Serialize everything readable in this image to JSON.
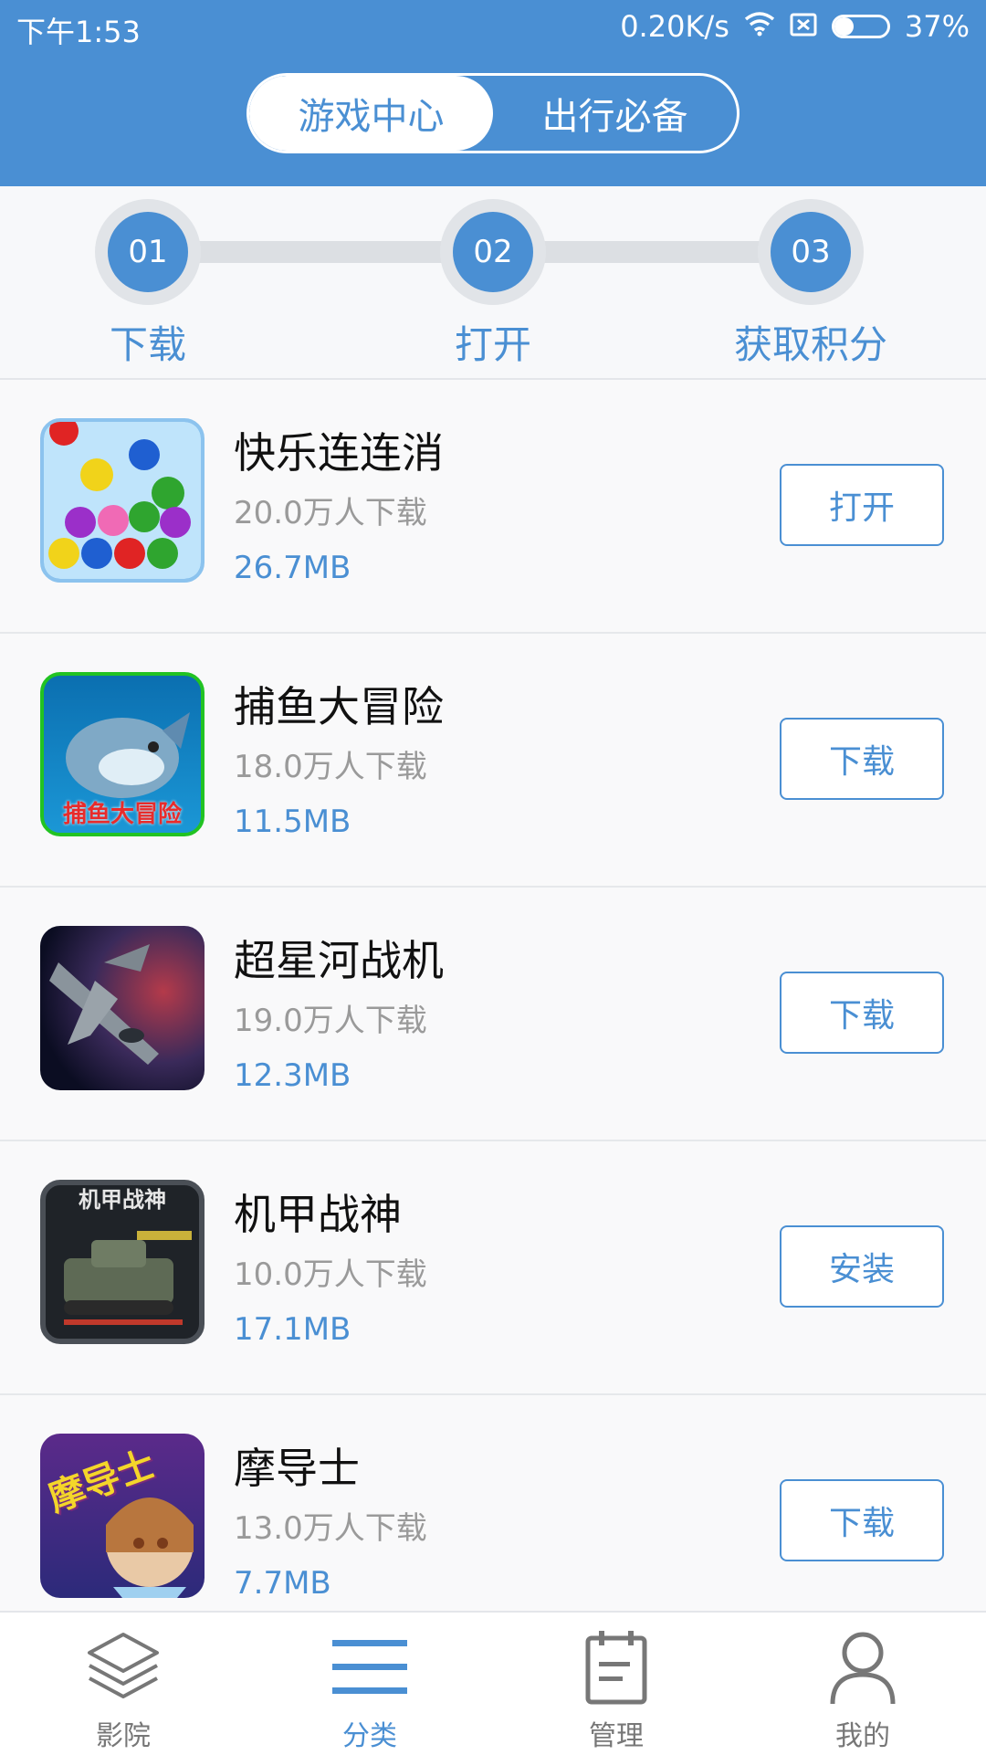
{
  "status_bar": {
    "time": "下午1:53",
    "net_speed": "0.20K/s",
    "battery": "37%",
    "battery_level": 0.37
  },
  "header": {
    "tabs": [
      {
        "label": "游戏中心",
        "active": true
      },
      {
        "label": "出行必备",
        "active": false
      }
    ]
  },
  "steps": [
    {
      "num": "01",
      "label": "下载"
    },
    {
      "num": "02",
      "label": "打开"
    },
    {
      "num": "03",
      "label": "获取积分"
    }
  ],
  "apps": [
    {
      "name": "快乐连连消",
      "downloads": "20.0万人下载",
      "size": "26.7MB",
      "action": "打开",
      "icon": "bubble-game-icon"
    },
    {
      "name": "捕鱼大冒险",
      "downloads": "18.0万人下载",
      "size": "11.5MB",
      "action": "下载",
      "icon": "fishing-game-icon",
      "icon_text": "捕鱼大冒险"
    },
    {
      "name": "超星河战机",
      "downloads": "19.0万人下载",
      "size": "12.3MB",
      "action": "下载",
      "icon": "fighter-jet-icon"
    },
    {
      "name": "机甲战神",
      "downloads": "10.0万人下载",
      "size": "17.1MB",
      "action": "安装",
      "icon": "mecha-tank-icon",
      "icon_text": "机甲战神"
    },
    {
      "name": "摩导士",
      "downloads": "13.0万人下载",
      "size": "7.7MB",
      "action": "下载",
      "icon": "anime-girl-icon",
      "icon_text": "摩导士"
    }
  ],
  "bottom_nav": [
    {
      "label": "影院",
      "icon": "layers-icon",
      "active": false
    },
    {
      "label": "分类",
      "icon": "menu-lines-icon",
      "active": true
    },
    {
      "label": "管理",
      "icon": "clipboard-icon",
      "active": false
    },
    {
      "label": "我的",
      "icon": "user-icon",
      "active": false
    }
  ],
  "colors": {
    "primary": "#4a8fd3",
    "background": "#f7f8fa"
  }
}
